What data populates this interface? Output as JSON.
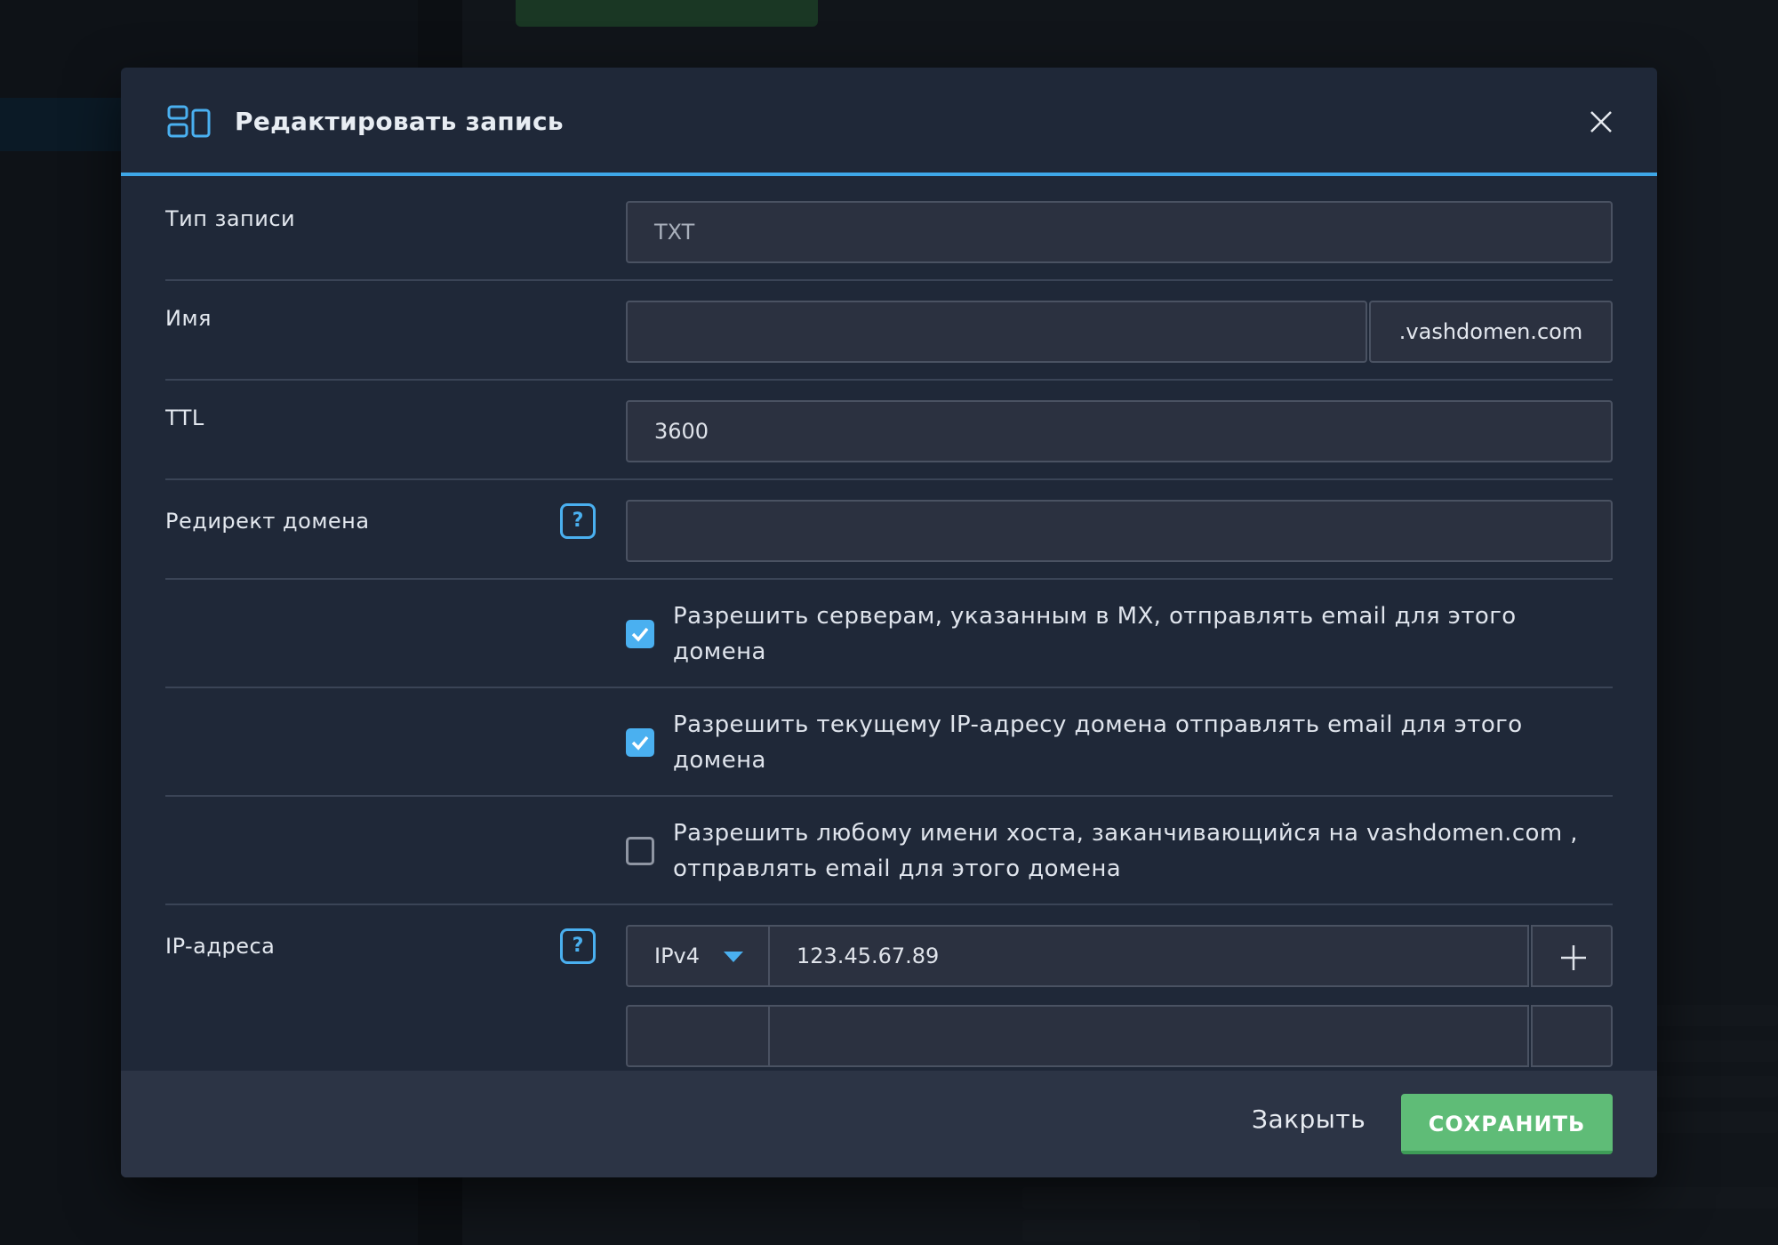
{
  "modal": {
    "title": "Редактировать запись",
    "close_label": "Закрыть",
    "save_label": "СОХРАНИТЬ"
  },
  "form": {
    "record_type": {
      "label": "Тип записи",
      "value": "TXT"
    },
    "name": {
      "label": "Имя",
      "value": "",
      "suffix": ".vashdomen.com"
    },
    "ttl": {
      "label": "TTL",
      "value": "3600"
    },
    "domain_redirect": {
      "label": "Редирект домена",
      "value": "",
      "help": "?"
    },
    "checks": [
      {
        "label": "Разрешить серверам, указанным в MX, отправлять email для этого домена",
        "checked": true
      },
      {
        "label": "Разрешить текущему IP-адресу домена отправлять email для этого домена",
        "checked": true
      },
      {
        "label": "Разрешить любому имени хоста, заканчивающийся на vashdomen.com , отправлять email для этого домена",
        "checked": false
      }
    ],
    "ip_addresses": {
      "label": "IP-адреса",
      "help": "?",
      "entries": [
        {
          "type": "IPv4",
          "value": "123.45.67.89"
        }
      ]
    }
  },
  "colors": {
    "accent": "#3ea7e8",
    "save_button": "#5fbc77",
    "modal_bg": "#1f2838"
  }
}
